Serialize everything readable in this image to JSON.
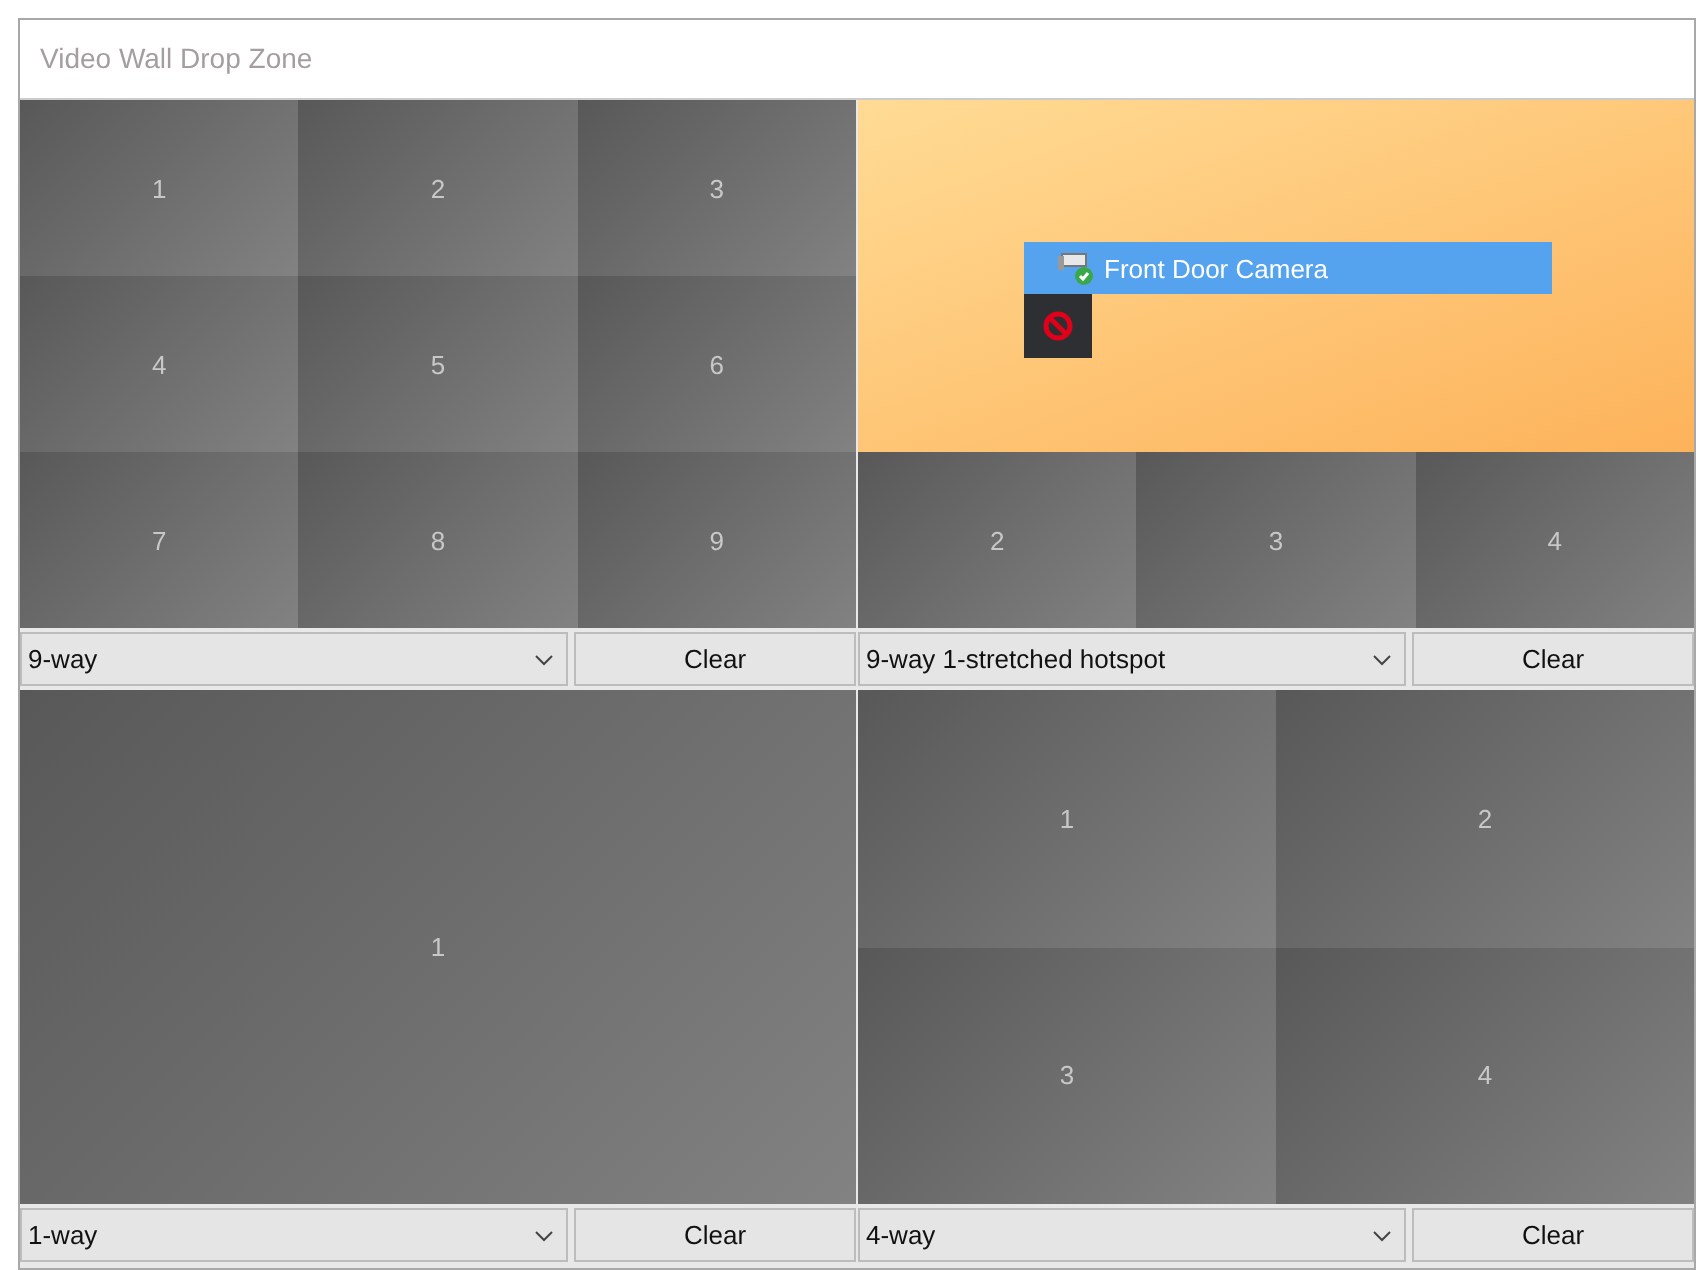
{
  "window": {
    "title": "Video Wall Drop Zone"
  },
  "panels": [
    {
      "kind": "nine",
      "layout": "9-way",
      "button": "Clear",
      "cells": [
        {
          "kind": "tile",
          "label": "1"
        },
        {
          "kind": "tile",
          "label": "2"
        },
        {
          "kind": "tile",
          "label": "3"
        },
        {
          "kind": "tile",
          "label": "4"
        },
        {
          "kind": "tile",
          "label": "5"
        },
        {
          "kind": "tile",
          "label": "6"
        },
        {
          "kind": "tile",
          "label": "7"
        },
        {
          "kind": "tile",
          "label": "8"
        },
        {
          "kind": "tile",
          "label": "9"
        }
      ]
    },
    {
      "kind": "hotspot",
      "layout": "9-way 1-stretched hotspot",
      "button": "Clear",
      "cells": [
        {
          "kind": "hotspot"
        },
        {
          "kind": "tile",
          "label": "2"
        },
        {
          "kind": "tile",
          "label": "3"
        },
        {
          "kind": "tile",
          "label": "4"
        }
      ]
    },
    {
      "kind": "single",
      "layout": "1-way",
      "button": "Clear",
      "cells": [
        {
          "kind": "tile",
          "label": "1"
        }
      ]
    },
    {
      "kind": "quad",
      "layout": "4-way",
      "button": "Clear",
      "cells": [
        {
          "kind": "tile",
          "label": "1"
        },
        {
          "kind": "tile",
          "label": "2"
        },
        {
          "kind": "tile",
          "label": "3"
        },
        {
          "kind": "tile",
          "label": "4"
        }
      ]
    }
  ],
  "drag": {
    "label": "Front Door Camera"
  }
}
